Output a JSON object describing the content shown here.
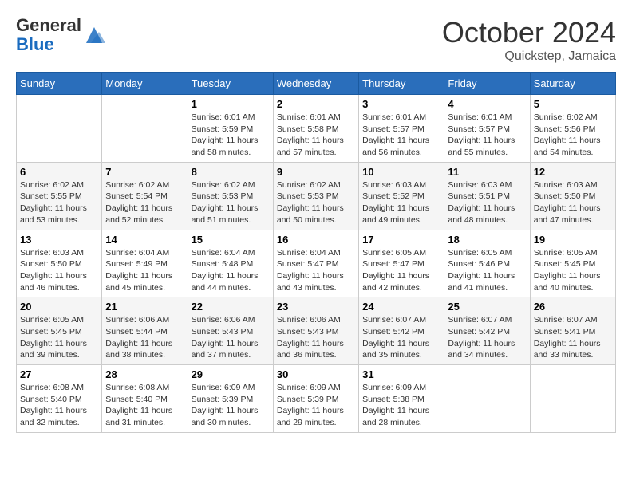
{
  "header": {
    "logo_general": "General",
    "logo_blue": "Blue",
    "month": "October 2024",
    "location": "Quickstep, Jamaica"
  },
  "weekdays": [
    "Sunday",
    "Monday",
    "Tuesday",
    "Wednesday",
    "Thursday",
    "Friday",
    "Saturday"
  ],
  "weeks": [
    [
      {
        "day": "",
        "info": ""
      },
      {
        "day": "",
        "info": ""
      },
      {
        "day": "1",
        "info": "Sunrise: 6:01 AM\nSunset: 5:59 PM\nDaylight: 11 hours and 58 minutes."
      },
      {
        "day": "2",
        "info": "Sunrise: 6:01 AM\nSunset: 5:58 PM\nDaylight: 11 hours and 57 minutes."
      },
      {
        "day": "3",
        "info": "Sunrise: 6:01 AM\nSunset: 5:57 PM\nDaylight: 11 hours and 56 minutes."
      },
      {
        "day": "4",
        "info": "Sunrise: 6:01 AM\nSunset: 5:57 PM\nDaylight: 11 hours and 55 minutes."
      },
      {
        "day": "5",
        "info": "Sunrise: 6:02 AM\nSunset: 5:56 PM\nDaylight: 11 hours and 54 minutes."
      }
    ],
    [
      {
        "day": "6",
        "info": "Sunrise: 6:02 AM\nSunset: 5:55 PM\nDaylight: 11 hours and 53 minutes."
      },
      {
        "day": "7",
        "info": "Sunrise: 6:02 AM\nSunset: 5:54 PM\nDaylight: 11 hours and 52 minutes."
      },
      {
        "day": "8",
        "info": "Sunrise: 6:02 AM\nSunset: 5:53 PM\nDaylight: 11 hours and 51 minutes."
      },
      {
        "day": "9",
        "info": "Sunrise: 6:02 AM\nSunset: 5:53 PM\nDaylight: 11 hours and 50 minutes."
      },
      {
        "day": "10",
        "info": "Sunrise: 6:03 AM\nSunset: 5:52 PM\nDaylight: 11 hours and 49 minutes."
      },
      {
        "day": "11",
        "info": "Sunrise: 6:03 AM\nSunset: 5:51 PM\nDaylight: 11 hours and 48 minutes."
      },
      {
        "day": "12",
        "info": "Sunrise: 6:03 AM\nSunset: 5:50 PM\nDaylight: 11 hours and 47 minutes."
      }
    ],
    [
      {
        "day": "13",
        "info": "Sunrise: 6:03 AM\nSunset: 5:50 PM\nDaylight: 11 hours and 46 minutes."
      },
      {
        "day": "14",
        "info": "Sunrise: 6:04 AM\nSunset: 5:49 PM\nDaylight: 11 hours and 45 minutes."
      },
      {
        "day": "15",
        "info": "Sunrise: 6:04 AM\nSunset: 5:48 PM\nDaylight: 11 hours and 44 minutes."
      },
      {
        "day": "16",
        "info": "Sunrise: 6:04 AM\nSunset: 5:47 PM\nDaylight: 11 hours and 43 minutes."
      },
      {
        "day": "17",
        "info": "Sunrise: 6:05 AM\nSunset: 5:47 PM\nDaylight: 11 hours and 42 minutes."
      },
      {
        "day": "18",
        "info": "Sunrise: 6:05 AM\nSunset: 5:46 PM\nDaylight: 11 hours and 41 minutes."
      },
      {
        "day": "19",
        "info": "Sunrise: 6:05 AM\nSunset: 5:45 PM\nDaylight: 11 hours and 40 minutes."
      }
    ],
    [
      {
        "day": "20",
        "info": "Sunrise: 6:05 AM\nSunset: 5:45 PM\nDaylight: 11 hours and 39 minutes."
      },
      {
        "day": "21",
        "info": "Sunrise: 6:06 AM\nSunset: 5:44 PM\nDaylight: 11 hours and 38 minutes."
      },
      {
        "day": "22",
        "info": "Sunrise: 6:06 AM\nSunset: 5:43 PM\nDaylight: 11 hours and 37 minutes."
      },
      {
        "day": "23",
        "info": "Sunrise: 6:06 AM\nSunset: 5:43 PM\nDaylight: 11 hours and 36 minutes."
      },
      {
        "day": "24",
        "info": "Sunrise: 6:07 AM\nSunset: 5:42 PM\nDaylight: 11 hours and 35 minutes."
      },
      {
        "day": "25",
        "info": "Sunrise: 6:07 AM\nSunset: 5:42 PM\nDaylight: 11 hours and 34 minutes."
      },
      {
        "day": "26",
        "info": "Sunrise: 6:07 AM\nSunset: 5:41 PM\nDaylight: 11 hours and 33 minutes."
      }
    ],
    [
      {
        "day": "27",
        "info": "Sunrise: 6:08 AM\nSunset: 5:40 PM\nDaylight: 11 hours and 32 minutes."
      },
      {
        "day": "28",
        "info": "Sunrise: 6:08 AM\nSunset: 5:40 PM\nDaylight: 11 hours and 31 minutes."
      },
      {
        "day": "29",
        "info": "Sunrise: 6:09 AM\nSunset: 5:39 PM\nDaylight: 11 hours and 30 minutes."
      },
      {
        "day": "30",
        "info": "Sunrise: 6:09 AM\nSunset: 5:39 PM\nDaylight: 11 hours and 29 minutes."
      },
      {
        "day": "31",
        "info": "Sunrise: 6:09 AM\nSunset: 5:38 PM\nDaylight: 11 hours and 28 minutes."
      },
      {
        "day": "",
        "info": ""
      },
      {
        "day": "",
        "info": ""
      }
    ]
  ]
}
